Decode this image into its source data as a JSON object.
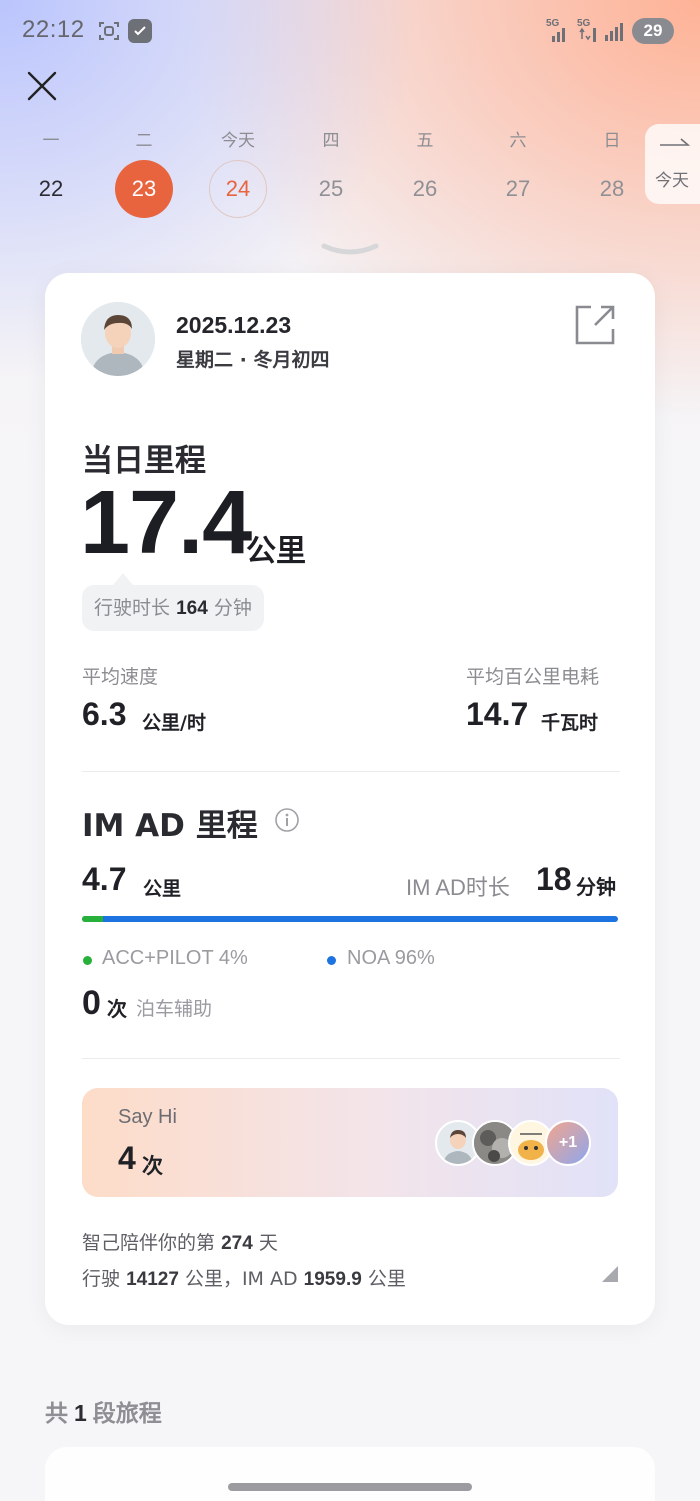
{
  "status_bar": {
    "time": "22:12",
    "sim1": "5G",
    "sim2": "5G",
    "battery": "29"
  },
  "calendar": {
    "days": [
      {
        "weekday": "一",
        "date": "22",
        "state": "past"
      },
      {
        "weekday": "二",
        "date": "23",
        "state": "selected"
      },
      {
        "weekday": "今天",
        "date": "24",
        "state": "today"
      },
      {
        "weekday": "四",
        "date": "25",
        "state": "future"
      },
      {
        "weekday": "五",
        "date": "26",
        "state": "future"
      },
      {
        "weekday": "六",
        "date": "27",
        "state": "future"
      },
      {
        "weekday": "日",
        "date": "28",
        "state": "future"
      }
    ],
    "today_button": "今天"
  },
  "card": {
    "date": "2025.12.23",
    "weekday_lunar": "星期二 · 冬月初四",
    "daily_title": "当日里程",
    "daily_distance": "17.4",
    "distance_unit": "公里",
    "duration_label": "行驶时长",
    "duration_value": "164",
    "duration_unit": "分钟",
    "avg_speed_label": "平均速度",
    "avg_speed_value": "6.3",
    "avg_speed_unit": "公里/时",
    "avg_consumption_label": "平均百公里电耗",
    "avg_consumption_value": "14.7",
    "avg_consumption_unit": "千瓦时"
  },
  "imad": {
    "title": "IM AD 里程",
    "distance": "4.7",
    "distance_unit": "公里",
    "duration_label": "IM AD时长",
    "duration_value": "18",
    "duration_unit": "分钟",
    "acc_label": "ACC+PILOT 4%",
    "acc_fraction": 0.04,
    "noa_label": "NOA 96%",
    "acc_color": "#27b03a",
    "noa_color": "#1d74e0",
    "parking_count": "0",
    "parking_unit": "次",
    "parking_label": "泊车辅助"
  },
  "sayhi": {
    "title": "Say Hi",
    "count": "4",
    "unit": "次",
    "extra": "+1"
  },
  "footer": {
    "line1_prefix": "智己陪伴你的第",
    "days": "274",
    "line1_suffix": "天",
    "line2_prefix": "行驶",
    "total_km": "14127",
    "line2_mid": "公里，IM AD",
    "imad_km": "1959.9",
    "line2_suffix": "公里"
  },
  "trips": {
    "prefix": "共",
    "count": "1",
    "suffix": "段旅程"
  },
  "colors": {
    "accent": "#e8643f"
  }
}
